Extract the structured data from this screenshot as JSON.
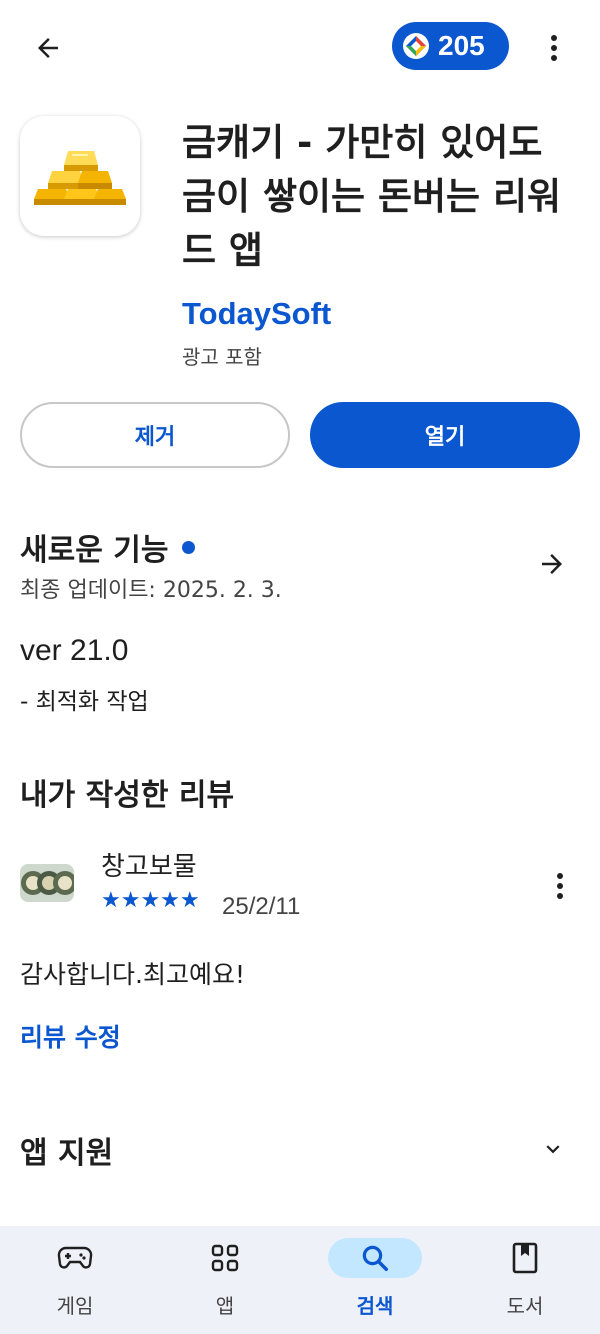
{
  "header": {
    "points": "205"
  },
  "app": {
    "title": "금캐기 - 가만히 있어도 금이 쌓이는 돈버는 리워드 앱",
    "developer": "TodaySoft",
    "ads_label": "광고 포함"
  },
  "actions": {
    "uninstall_label": "제거",
    "open_label": "열기"
  },
  "whats_new": {
    "title": "새로운 기능",
    "updated": "최종 업데이트: 2025. 2. 3.",
    "version": "ver 21.0",
    "notes": "- 최적화 작업"
  },
  "my_review": {
    "title": "내가 작성한 리뷰",
    "reviewer": "창고보물",
    "rating": 5,
    "stars": "★★★★★",
    "date": "25/2/11",
    "text": "감사합니다.최고예요!",
    "edit_label": "리뷰 수정"
  },
  "support": {
    "title": "앱 지원"
  },
  "bottom_nav": {
    "items": [
      {
        "label": "게임",
        "icon": "gamepad-icon"
      },
      {
        "label": "앱",
        "icon": "apps-grid-icon"
      },
      {
        "label": "검색",
        "icon": "search-icon",
        "active": true
      },
      {
        "label": "도서",
        "icon": "book-icon"
      }
    ]
  },
  "colors": {
    "accent": "#0b57d0",
    "nav_background": "#eef2f8",
    "active_pill": "#c2e7ff"
  }
}
